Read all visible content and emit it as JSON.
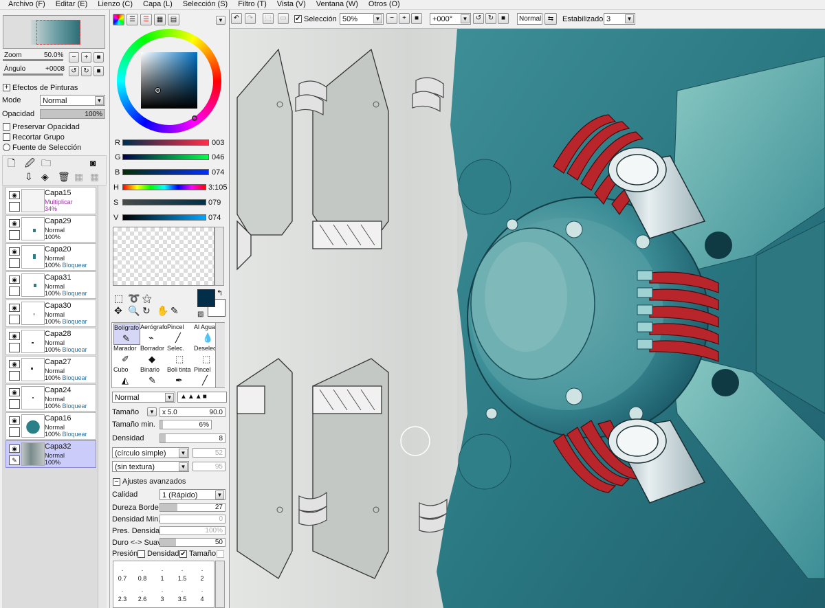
{
  "menu": {
    "items": [
      "Archivo (F)",
      "Editar (E)",
      "Lienzo (C)",
      "Capa (L)",
      "Selección (S)",
      "Filtro (T)",
      "Vista (V)",
      "Ventana (W)",
      "Otros (O)"
    ]
  },
  "navigator": {
    "zoom_label": "Zoom",
    "zoom_value": "50.0%",
    "angle_label": "Ángulo",
    "angle_value": "+0008"
  },
  "paint_effects": {
    "title": "Efectos de Pinturas",
    "mode_label": "Mode",
    "mode_value": "Normal",
    "opacity_label": "Opacidad",
    "opacity_value": "100%",
    "preserve_opacity": "Preservar Opacidad",
    "clip_group": "Recortar Grupo",
    "selection_source": "Fuente de Selección"
  },
  "layers": [
    {
      "name": "Capa15",
      "mode": "Multiplicar",
      "opacity": "34%",
      "lock": ""
    },
    {
      "name": "Capa29",
      "mode": "Normal",
      "opacity": "100%",
      "lock": ""
    },
    {
      "name": "Capa20",
      "mode": "Normal",
      "opacity": "100%",
      "lock": "Bloquear"
    },
    {
      "name": "Capa31",
      "mode": "Normal",
      "opacity": "100%",
      "lock": "Bloquear"
    },
    {
      "name": "Capa30",
      "mode": "Normal",
      "opacity": "100%",
      "lock": "Bloquear"
    },
    {
      "name": "Capa28",
      "mode": "Normal",
      "opacity": "100%",
      "lock": "Bloquear"
    },
    {
      "name": "Capa27",
      "mode": "Normal",
      "opacity": "100%",
      "lock": "Bloquear"
    },
    {
      "name": "Capa24",
      "mode": "Normal",
      "opacity": "100%",
      "lock": "Bloquear"
    },
    {
      "name": "Capa16",
      "mode": "Normal",
      "opacity": "100%",
      "lock": "Bloquear"
    },
    {
      "name": "Capa32",
      "mode": "Normal",
      "opacity": "100%",
      "lock": ""
    }
  ],
  "color": {
    "r_label": "R",
    "r_value": "003",
    "g_label": "G",
    "g_value": "046",
    "b_label": "B",
    "b_value": "074",
    "h_label": "H",
    "h_value": "3:105",
    "s_label": "S",
    "s_value": "079",
    "v_label": "V",
    "v_value": "074",
    "primary": "#032e4a",
    "secondary": "#ffffff"
  },
  "tools": [
    {
      "label": "Bolígrafo",
      "icon": "pen-icon"
    },
    {
      "label": "Aerógrafo",
      "icon": "airbrush-icon"
    },
    {
      "label": "Pincel",
      "icon": "brush-icon"
    },
    {
      "label": "Al Agua",
      "icon": "water-icon"
    },
    {
      "label": "Marador",
      "icon": "marker-icon"
    },
    {
      "label": "Borrador",
      "icon": "eraser-icon"
    },
    {
      "label": "Selec.",
      "icon": "select-pen-icon"
    },
    {
      "label": "Deselec.",
      "icon": "deselect-icon"
    },
    {
      "label": "Cubo",
      "icon": "bucket-icon"
    },
    {
      "label": "Binario",
      "icon": "binary-icon"
    },
    {
      "label": "Boli tinta",
      "icon": "ink-pen-icon"
    },
    {
      "label": "Pincel",
      "icon": "brush-icon"
    }
  ],
  "brush": {
    "blend_mode": "Normal",
    "size_label": "Tamaño",
    "size_mult": "x 5.0",
    "size_value": "90.0",
    "min_size_label": "Tamaño min.",
    "min_size_value": "6%",
    "density_label": "Densidad",
    "density_value": "8",
    "shape": "(círculo simple)",
    "shape_value": "52",
    "texture": "(sin textura)",
    "texture_value": "95",
    "advanced_label": "Ajustes avanzados",
    "quality_label": "Calidad",
    "quality_value": "1 (Rápido)",
    "edge_hardness_label": "Dureza Borde",
    "edge_hardness_value": "27",
    "min_density_label": "Densidad Min.",
    "min_density_value": "0",
    "max_density_pressure_label": "Pres. Densidad Máx.",
    "max_density_pressure_value": "100%",
    "hard_soft_label": "Duro <-> Suave",
    "hard_soft_value": "50",
    "pressure_label": "Presión:",
    "pressure_density": "Densidad",
    "pressure_size": "Tamaño"
  },
  "brush_presets": {
    "row1": [
      ".",
      ".",
      ".",
      ".",
      "."
    ],
    "row2": [
      "0.7",
      "0.8",
      "1",
      "1.5",
      "2"
    ],
    "row3": [
      ".",
      ".",
      ".",
      ".",
      "."
    ],
    "row4": [
      "2.3",
      "2.6",
      "3",
      "3.5",
      "4"
    ]
  },
  "toolbar": {
    "selection_label": "Selección",
    "zoom_value": "50%",
    "angle_value": "+000°",
    "blend_value": "Normal",
    "stabilizer_label": "Estabilizador",
    "stabilizer_value": "3"
  }
}
